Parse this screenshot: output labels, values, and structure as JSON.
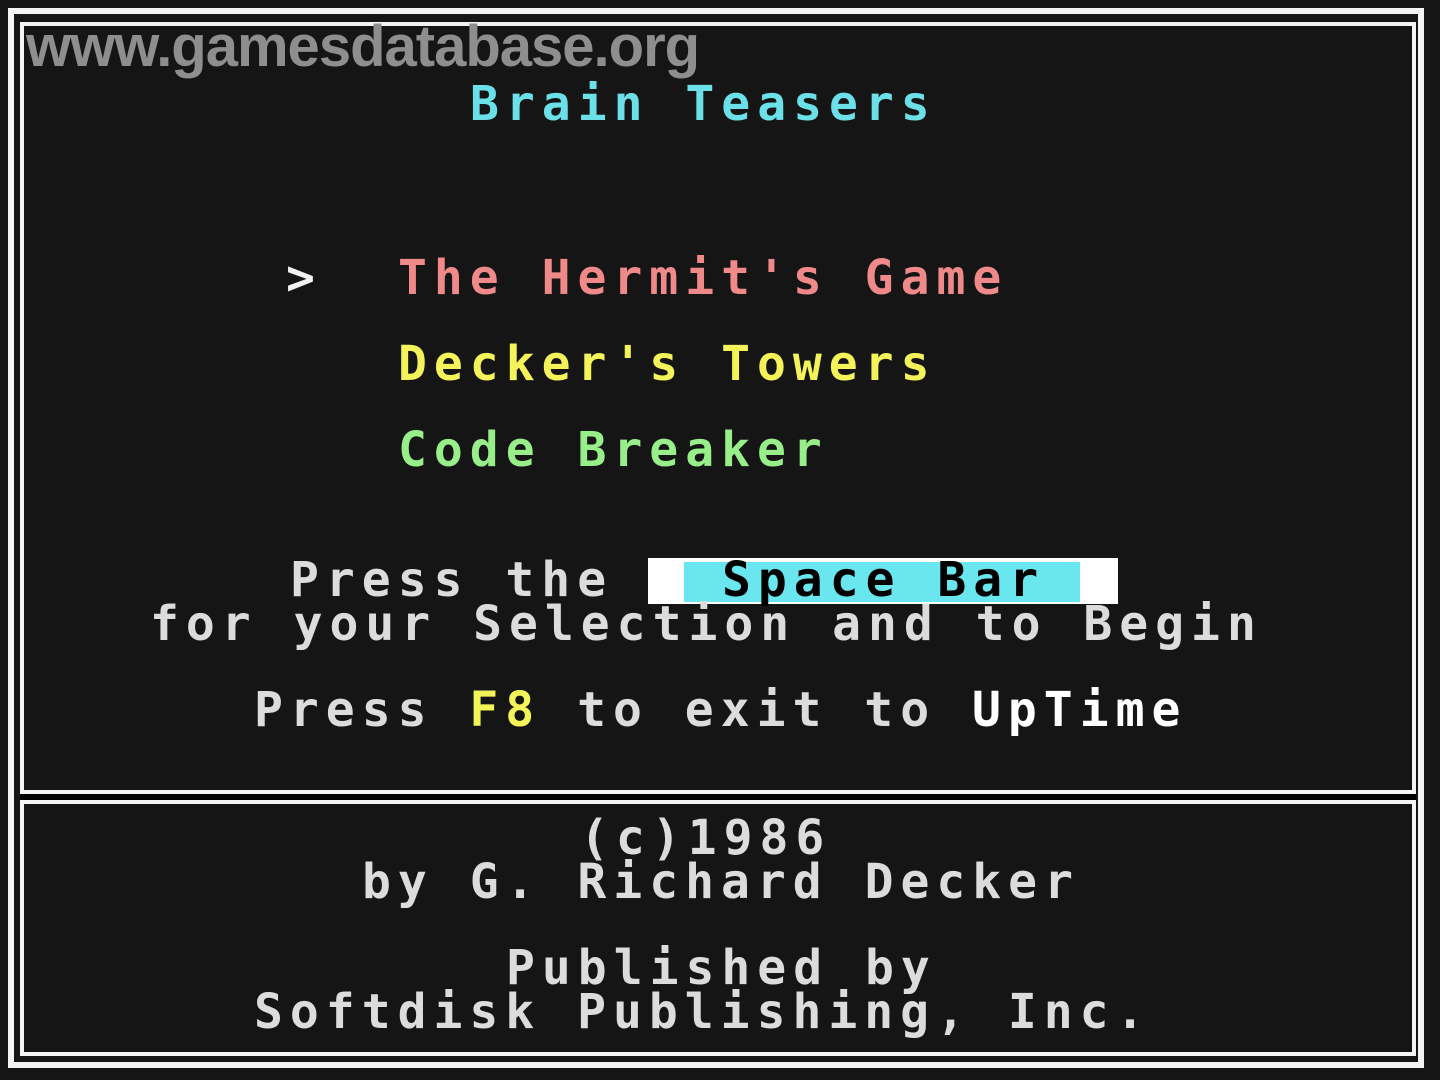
{
  "watermark": "www.gamesdatabase.org",
  "title": "Brain Teasers",
  "menu": {
    "cursor": ">",
    "items": [
      {
        "label": "The Hermit's Game",
        "color": "#f08a8a"
      },
      {
        "label": "Decker's Towers",
        "color": "#f4f45a"
      },
      {
        "label": "Code Breaker",
        "color": "#98ee88"
      }
    ]
  },
  "instructions": {
    "press_prefix": "Press the",
    "key_label": "Space Bar",
    "selection_line": "for your Selection and to Begin",
    "exit_prefix": "Press",
    "exit_key": "F8",
    "exit_middle": "to exit to",
    "exit_app": "UpTime"
  },
  "credits": {
    "copyright": "(c)1986",
    "author": "by G. Richard Decker",
    "published_label": "Published by",
    "publisher": "Softdisk Publishing, Inc."
  },
  "colors": {
    "background": "#151515",
    "border": "#f4f4f4",
    "title": "#6ce0e8",
    "text": "#dcdcdc",
    "highlight": "#6ae6ee"
  }
}
